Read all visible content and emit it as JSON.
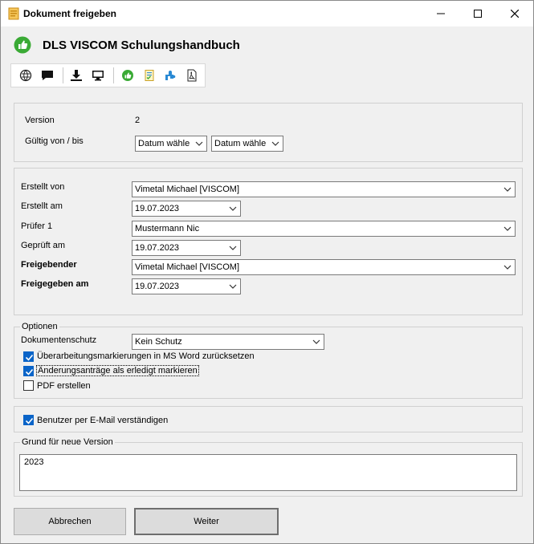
{
  "window": {
    "title": "Dokument freigeben"
  },
  "document": {
    "title": "DLS VISCOM Schulungshandbuch"
  },
  "toolbar": {
    "icons": [
      "globe-icon",
      "comment-icon",
      "download-icon",
      "monitor-icon",
      "green-thumb-icon",
      "checklist-icon",
      "puzzle-icon",
      "pdf-icon"
    ]
  },
  "version": {
    "version_label": "Version",
    "version_value": "2",
    "valid_label": "Gültig von / bis",
    "valid_from": "Datum wähle",
    "valid_to": "Datum wähle"
  },
  "approval": {
    "created_by_label": "Erstellt von",
    "created_by": "Vimetal Michael [VISCOM]",
    "created_at_label": "Erstellt am",
    "created_at": "19.07.2023",
    "reviewer_label": "Prüfer 1",
    "reviewer": "Mustermann Nic",
    "reviewed_at_label": "Geprüft am",
    "reviewed_at": "19.07.2023",
    "approver_label": "Freigebender",
    "approver": "Vimetal Michael [VISCOM]",
    "approved_at_label": "Freigegeben am",
    "approved_at": "19.07.2023"
  },
  "options": {
    "title": "Optionen",
    "protection_label": "Dokumentenschutz",
    "protection": "Kein Schutz",
    "reset_markup": {
      "label": "Überarbeitungsmarkierungen in MS Word zurücksetzen",
      "checked": true
    },
    "mark_requests": {
      "label": "Änderungsanträge als erledigt markieren",
      "checked": true
    },
    "create_pdf": {
      "label": "PDF erstellen",
      "checked": false
    }
  },
  "notify": {
    "label": "Benutzer per E-Mail verständigen",
    "checked": true
  },
  "reason": {
    "title": "Grund für neue Version",
    "value": "2023"
  },
  "buttons": {
    "cancel": "Abbrechen",
    "next": "Weiter"
  },
  "colors": {
    "accent": "#0a64c8",
    "thumb_green": "#3aaa35"
  }
}
